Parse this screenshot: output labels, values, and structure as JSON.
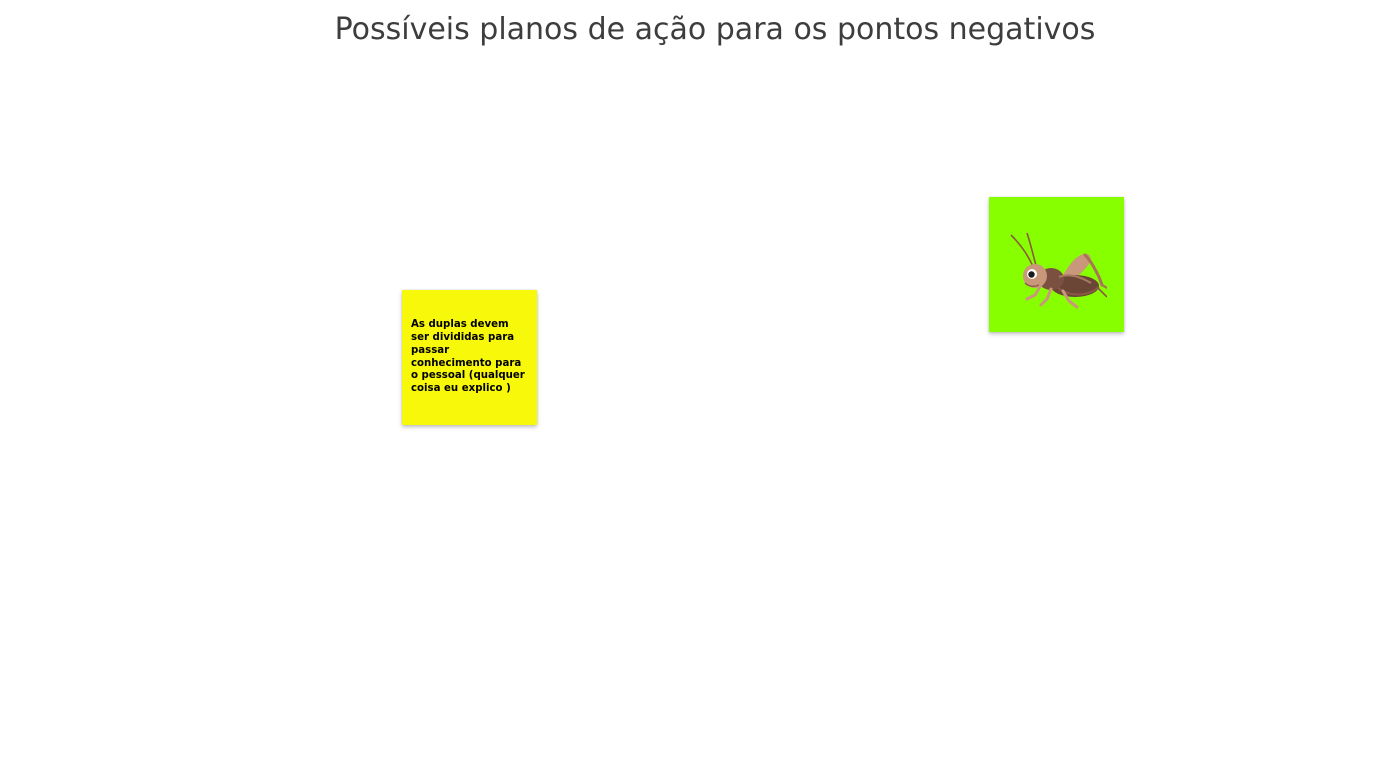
{
  "board": {
    "title": "Possíveis planos de ação para os pontos negativos"
  },
  "notes": [
    {
      "text": "As duplas devem ser divididas para passar conhecimento para o pessoal (qualquer coisa eu explico )",
      "color": "#f8f80a"
    },
    {
      "text": "",
      "color": "#88ff00",
      "icon": "cricket-icon"
    }
  ],
  "colors": {
    "background": "#ffffff",
    "title": "#3d3d3d"
  }
}
